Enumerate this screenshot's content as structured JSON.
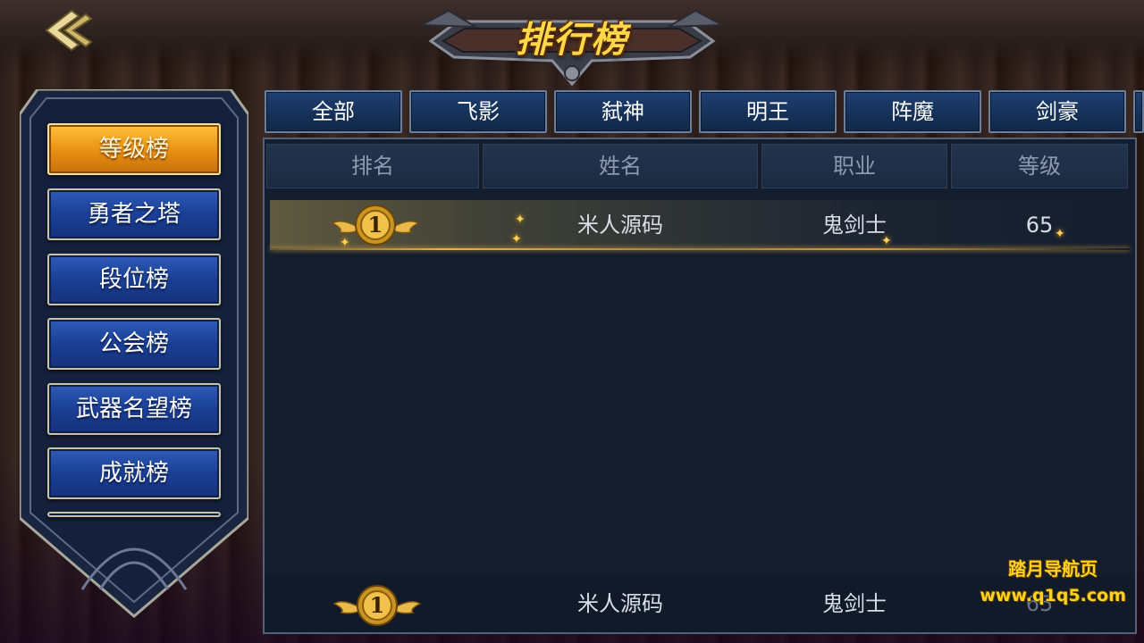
{
  "header": {
    "title": "排行榜",
    "back_icon": "back-arrow-icon"
  },
  "sidebar": {
    "items": [
      {
        "label": "等级榜",
        "active": true
      },
      {
        "label": "勇者之塔",
        "active": false
      },
      {
        "label": "段位榜",
        "active": false
      },
      {
        "label": "公会榜",
        "active": false
      },
      {
        "label": "武器名望榜",
        "active": false
      },
      {
        "label": "成就榜",
        "active": false
      }
    ]
  },
  "tabs": [
    {
      "label": "全部"
    },
    {
      "label": "飞影"
    },
    {
      "label": "弑神"
    },
    {
      "label": "明王"
    },
    {
      "label": "阵魔"
    },
    {
      "label": "剑豪"
    }
  ],
  "table": {
    "columns": [
      "排名",
      "姓名",
      "职业",
      "等级"
    ],
    "rows": [
      {
        "rank": "1",
        "name": "米人源码",
        "job": "鬼剑士",
        "level": "65"
      }
    ]
  },
  "my_rank": {
    "rank": "1",
    "name": "米人源码",
    "job": "鬼剑士",
    "level": "65"
  },
  "watermark": {
    "line1": "踏月导航页",
    "line2": "www.q1q5.com"
  },
  "colors": {
    "active_tab": "#e78f12",
    "button_blue": "#1a3f95",
    "medal_gold": "#f2c14a",
    "watermark": "#ffd21f"
  }
}
